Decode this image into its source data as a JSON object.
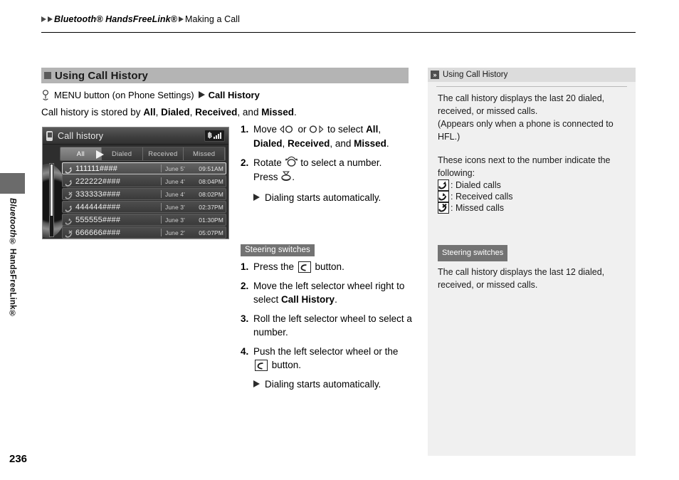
{
  "header": {
    "crumb_1": "Bluetooth® HandsFreeLink®",
    "crumb_2": "Making a Call"
  },
  "side_tab": {
    "label_italic": "Bluetooth®",
    "label_rest": " HandsFreeLink®"
  },
  "page": {
    "number": "236"
  },
  "section": {
    "title": "Using Call History",
    "menu_path_prefix": "MENU button (on Phone Settings)",
    "menu_path_target": "Call History",
    "stored_by_prefix": "Call history is stored by ",
    "stored_by_all": "All",
    "stored_by_sep1": ", ",
    "stored_by_dialed": "Dialed",
    "stored_by_sep2": ", ",
    "stored_by_received": "Received",
    "stored_by_sep3": ", and ",
    "stored_by_missed": "Missed",
    "stored_by_end": "."
  },
  "device": {
    "title": "Call history",
    "status_bluetooth": "฿",
    "tabs": [
      {
        "label": "All",
        "active": true
      },
      {
        "label": "Dialed",
        "active": false
      },
      {
        "label": "Received",
        "active": false
      },
      {
        "label": "Missed",
        "active": false
      }
    ],
    "rows": [
      {
        "icon": "dialed-call-icon",
        "number": "111111####",
        "date": "June 5'",
        "time": "09:51AM",
        "selected": true
      },
      {
        "icon": "dialed-call-icon",
        "number": "222222####",
        "date": "June 4'",
        "time": "08:04PM",
        "selected": false
      },
      {
        "icon": "missed-call-icon",
        "number": "333333####",
        "date": "June 4'",
        "time": "08:02PM",
        "selected": false
      },
      {
        "icon": "dialed-call-icon",
        "number": "444444####",
        "date": "June 3'",
        "time": "02:37PM",
        "selected": false
      },
      {
        "icon": "received-call-icon",
        "number": "555555####",
        "date": "June 3'",
        "time": "01:30PM",
        "selected": false
      },
      {
        "icon": "missed-call-icon",
        "number": "666666####",
        "date": "June 2'",
        "time": "05:07PM",
        "selected": false
      }
    ]
  },
  "steps": {
    "s1_num": "1.",
    "s1_a": "Move ",
    "s1_b": " or ",
    "s1_c": " to select ",
    "s1_all": "All",
    "s1_comma": ", ",
    "s1_dialed": "Dialed",
    "s1_comma2": ", ",
    "s1_received": "Received",
    "s1_and": ", and ",
    "s1_missed": "Missed",
    "s1_end": ".",
    "s2_num": "2.",
    "s2_a": "Rotate ",
    "s2_b": " to select a number.",
    "s2_c": "Press ",
    "s2_d": ".",
    "note_dialing": "Dialing starts automatically."
  },
  "steering": {
    "badge": "Steering switches",
    "s1_num": "1.",
    "s1_a": "Press the ",
    "s1_b": " button.",
    "s2_num": "2.",
    "s2_a": "Move the left selector wheel right to select ",
    "s2_bold": "Call History",
    "s2_end": ".",
    "s3_num": "3.",
    "s3_a": "Roll the left selector wheel to select a number.",
    "s4_num": "4.",
    "s4_a": "Push the left selector wheel or the ",
    "s4_b": " button.",
    "note_dialing": "Dialing starts automatically."
  },
  "info": {
    "head_title": "Using Call History",
    "para1_line1": "The call history displays the last 20 dialed,",
    "para1_line2": "received, or missed calls.",
    "para1_line3": "(Appears only when a phone is connected to",
    "para1_line4": "HFL.)",
    "para2_line1": "These icons next to the number indicate the",
    "para2_line2": "following:",
    "legend": [
      {
        "icon": "dialed-call-icon",
        "label": ": Dialed calls"
      },
      {
        "icon": "received-call-icon",
        "label": ": Received calls"
      },
      {
        "icon": "missed-call-icon",
        "label": ": Missed calls"
      }
    ],
    "steer_badge": "Steering switches",
    "steer_line1": "The call history displays the last 12 dialed,",
    "steer_line2": "received, or missed calls."
  },
  "colors": {
    "section_bar": "#b4b4b4",
    "badge": "#737373",
    "info_panel": "#f0f0f0",
    "info_head": "#dcdcdc",
    "device_bg": "#2e2e2e"
  }
}
